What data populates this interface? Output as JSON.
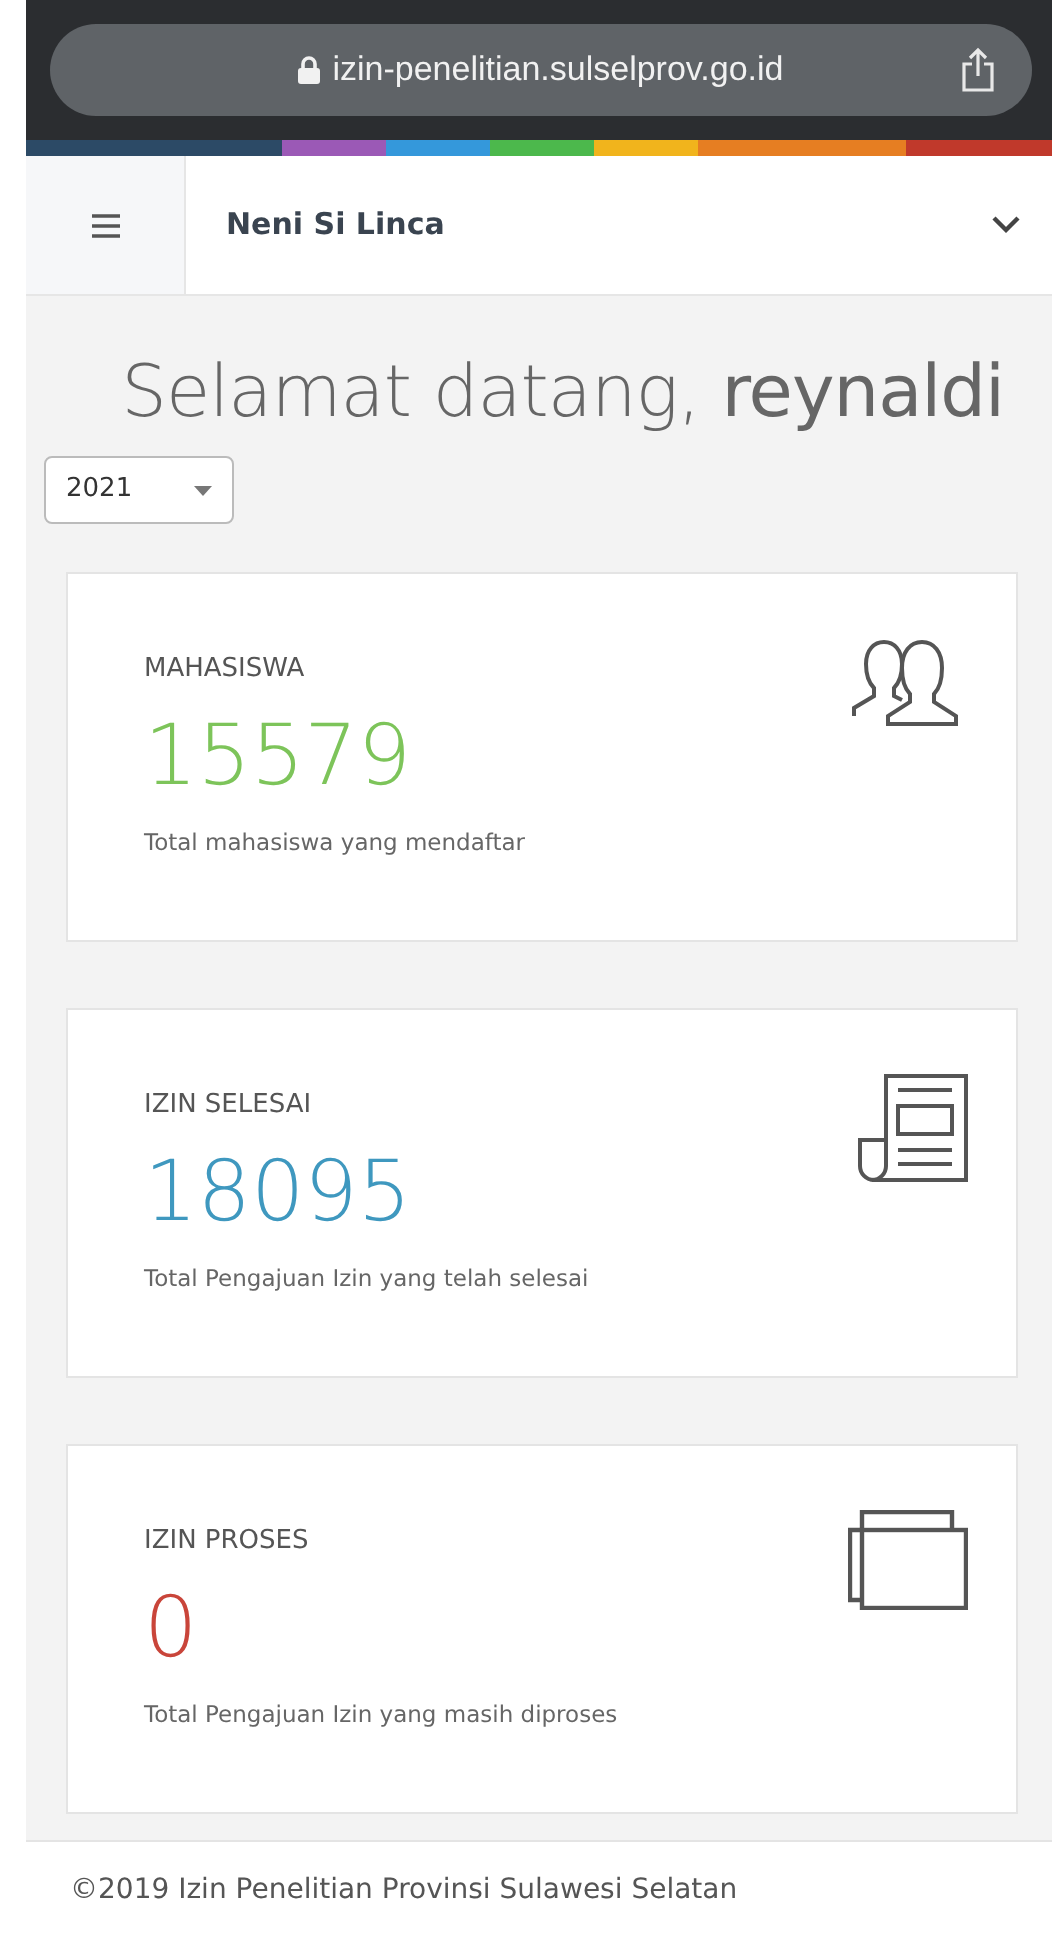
{
  "browser": {
    "url": "izin-penelitian.sulselprov.go.id"
  },
  "navbar": {
    "user_name": "Neni Si Linca"
  },
  "welcome": "Selamat datang, **reynaldi**",
  "year_select": {
    "value": "2021"
  },
  "stats": [
    {
      "kind": "users",
      "title": "MAHASISWA",
      "value": "15579",
      "color": "#7dc45a",
      "caption": "Total mahasiswa yang mendaftar"
    },
    {
      "kind": "document",
      "title": "IZIN SELESAI",
      "value": "18095",
      "color": "#3f98bf",
      "caption": "Total Pengajuan Izin yang telah selesai"
    },
    {
      "kind": "windows",
      "title": "IZIN PROSES",
      "value": "0",
      "color": "#c9453a",
      "caption": "Total Pengajuan Izin yang masih diproses"
    }
  ],
  "footer": "©2019 Izin Penelitian Provinsi Sulawesi Selatan"
}
